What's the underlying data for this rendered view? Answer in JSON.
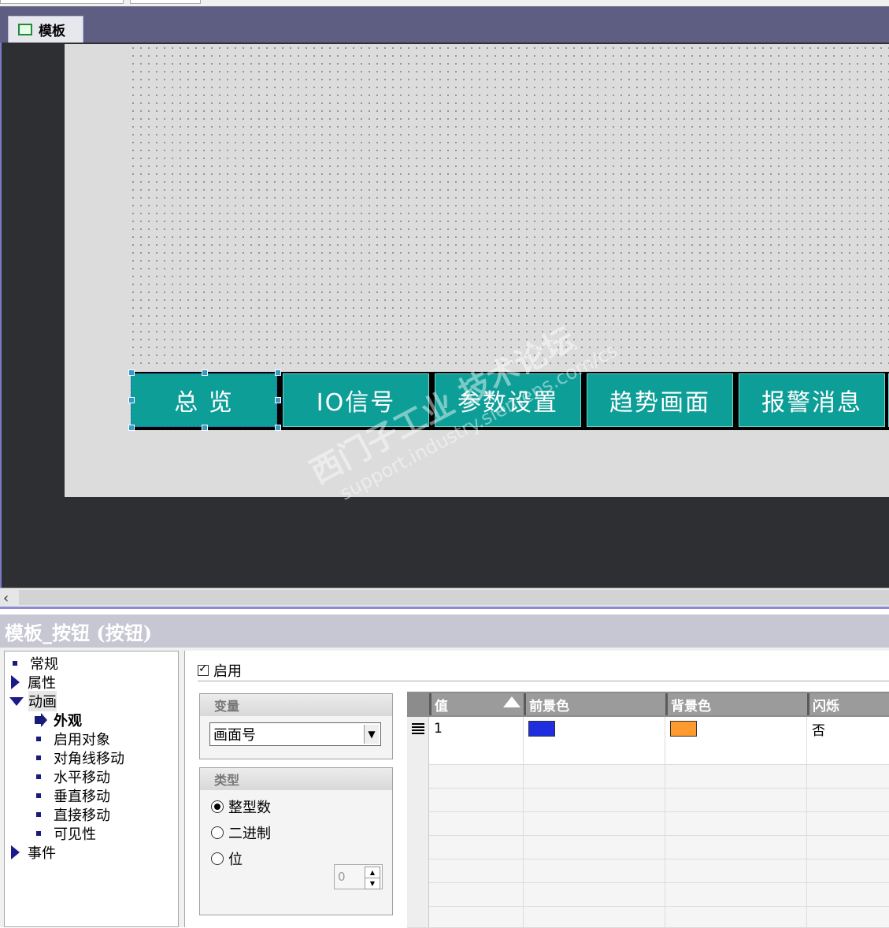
{
  "tabs": [
    {
      "label": "模板"
    }
  ],
  "screen": {
    "nav_buttons": [
      {
        "label": "总 览",
        "selected": true
      },
      {
        "label": "IO信号",
        "selected": false
      },
      {
        "label": "参数设置",
        "selected": false
      },
      {
        "label": "趋势画面",
        "selected": false
      },
      {
        "label": "报警消息",
        "selected": false
      }
    ],
    "button_color": "#0e9e98",
    "watermark": {
      "line1": "西门子工业 技术论坛",
      "line2": "support.industry.siemens.com/cs"
    }
  },
  "scrollbar": {
    "left_arrow": "‹"
  },
  "inspector": {
    "title": "模板_按钮 (按钮)",
    "tree": {
      "general": "常规",
      "properties": "属性",
      "animation": "动画",
      "appearance": "外观",
      "enable_object": "启用对象",
      "diagonal_move": "对角线移动",
      "horizontal_move": "水平移动",
      "vertical_move": "垂直移动",
      "direct_move": "直接移动",
      "visibility": "可见性",
      "events": "事件"
    },
    "enable_label": "启用",
    "variable_group": {
      "title": "变量",
      "value": "画面号"
    },
    "type_group": {
      "title": "类型",
      "options": [
        "整型数",
        "二进制",
        "位"
      ],
      "selected": "整型数",
      "bit_value": "0"
    },
    "table": {
      "columns": [
        "值",
        "前景色",
        "背景色",
        "闪烁"
      ],
      "rows": [
        {
          "value": "1",
          "foreground": "#1f2fe0",
          "background": "#ff9a2e",
          "flash": "否"
        }
      ]
    }
  }
}
